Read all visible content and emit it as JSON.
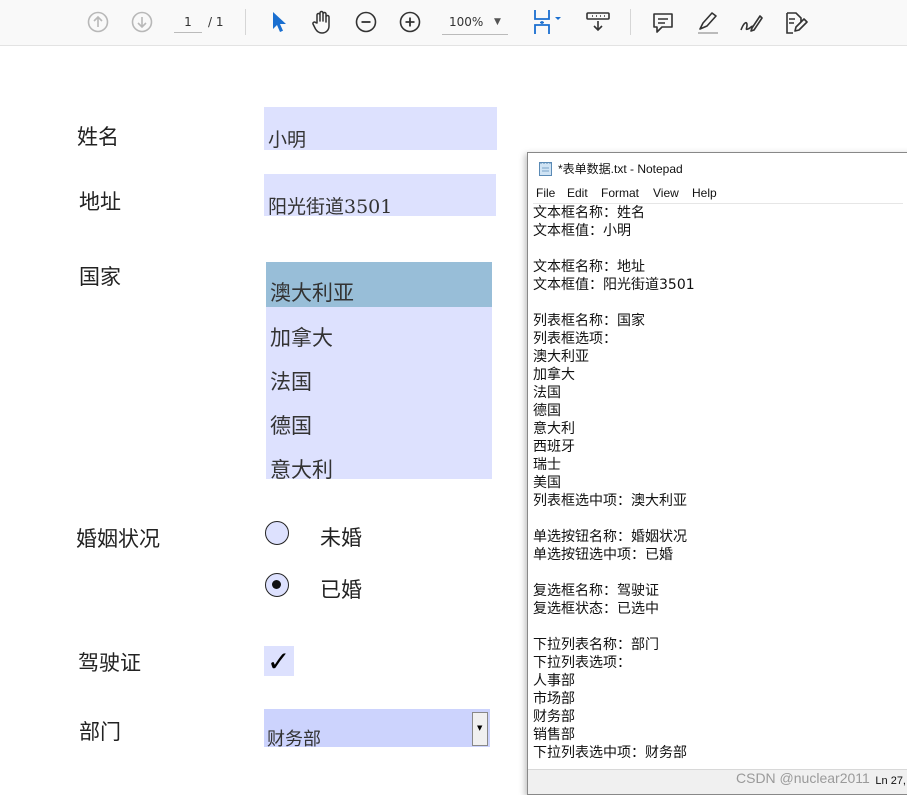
{
  "toolbar": {
    "page_current": "1",
    "page_total": "/ 1",
    "zoom": "100%",
    "icons": [
      "arrow-up-circle-icon",
      "arrow-down-circle-icon",
      "pointer-icon",
      "hand-icon",
      "zoom-out-icon",
      "zoom-in-icon",
      "fit-page-icon",
      "scroll-mode-icon",
      "comment-icon",
      "highlight-icon",
      "sign-icon",
      "edit-icon"
    ],
    "accent_color": "#1a6fd0"
  },
  "form": {
    "name_label": "姓名",
    "name_value": "小明",
    "address_label": "地址",
    "address_value": "阳光街道3501",
    "country_label": "国家",
    "country_options": [
      "澳大利亚",
      "加拿大",
      "法国",
      "德国",
      "意大利"
    ],
    "country_selected": "澳大利亚",
    "marital_label": "婚姻状况",
    "marital_options": [
      "未婚",
      "已婚"
    ],
    "marital_selected": "已婚",
    "license_label": "驾驶证",
    "license_checked": true,
    "license_mark": "✓",
    "dept_label": "部门",
    "dept_value": "财务部",
    "field_color": "#dde1fe",
    "selected_color": "#98bed8"
  },
  "notepad": {
    "title": "*表单数据.txt - Notepad",
    "menu": [
      "File",
      "Edit",
      "Format",
      "View",
      "Help"
    ],
    "content": "文本框名称：姓名\n文本框值：小明\n\n文本框名称：地址\n文本框值：阳光街道3501\n\n列表框名称：国家\n列表框选项：\n澳大利亚\n加拿大\n法国\n德国\n意大利\n西班牙\n瑞士\n美国\n列表框选中项：澳大利亚\n\n单选按钮名称：婚姻状况\n单选按钮选中项：已婚\n\n复选框名称：驾驶证\n复选框状态：已选中\n\n下拉列表名称：部门\n下拉列表选项：\n人事部\n市场部\n财务部\n销售部\n下拉列表选中项：财务部",
    "status": "Ln 27,"
  },
  "watermark": "CSDN @nuclear2011"
}
